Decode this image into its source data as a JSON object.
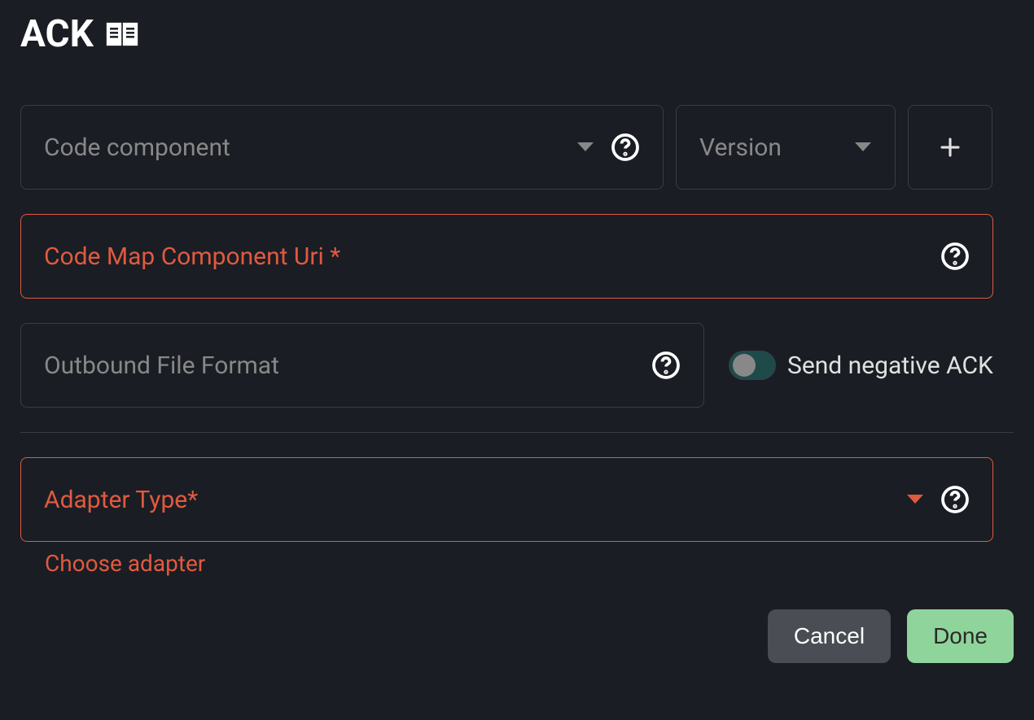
{
  "header": {
    "title": "ACK"
  },
  "fields": {
    "codeComponent": {
      "label": "Code component"
    },
    "version": {
      "label": "Version"
    },
    "codeMapUri": {
      "label": "Code Map Component Uri *"
    },
    "outboundFormat": {
      "label": "Outbound File Format"
    },
    "adapterType": {
      "label": "Adapter Type*",
      "helperText": "Choose adapter"
    }
  },
  "toggle": {
    "label": "Send negative ACK"
  },
  "buttons": {
    "cancel": "Cancel",
    "done": "Done"
  }
}
